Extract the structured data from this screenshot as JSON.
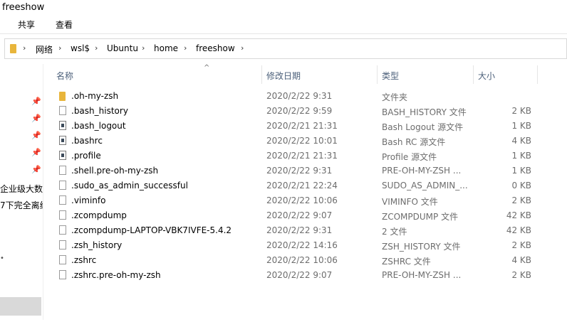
{
  "window": {
    "title": "freeshow"
  },
  "ribbon": {
    "tabs": [
      "共享",
      "查看"
    ]
  },
  "breadcrumb": [
    "网络",
    "wsl$",
    "Ubuntu",
    "home",
    "freeshow"
  ],
  "left_pane": {
    "text1": "企业级大数",
    "text2": "7下完全离线",
    "pin_glyph": "📌"
  },
  "columns": {
    "name": "名称",
    "date": "修改日期",
    "type": "类型",
    "size": "大小"
  },
  "files": [
    {
      "name": ".oh-my-zsh",
      "date": "2020/2/22 9:31",
      "type": "文件夹",
      "size": "",
      "icon": "folder-icon"
    },
    {
      "name": ".bash_history",
      "date": "2020/2/22 9:59",
      "type": "BASH_HISTORY 文件",
      "size": "2 KB",
      "icon": "file-icon"
    },
    {
      "name": ".bash_logout",
      "date": "2020/2/21 21:31",
      "type": "Bash Logout 源文件",
      "size": "1 KB",
      "icon": "shell-script-icon"
    },
    {
      "name": ".bashrc",
      "date": "2020/2/22 10:01",
      "type": "Bash RC 源文件",
      "size": "4 KB",
      "icon": "shell-script-icon"
    },
    {
      "name": ".profile",
      "date": "2020/2/21 21:31",
      "type": "Profile 源文件",
      "size": "1 KB",
      "icon": "shell-script-icon"
    },
    {
      "name": ".shell.pre-oh-my-zsh",
      "date": "2020/2/22 9:31",
      "type": "PRE-OH-MY-ZSH ...",
      "size": "1 KB",
      "icon": "file-icon"
    },
    {
      "name": ".sudo_as_admin_successful",
      "date": "2020/2/21 22:24",
      "type": "SUDO_AS_ADMIN_...",
      "size": "0 KB",
      "icon": "file-icon"
    },
    {
      "name": ".viminfo",
      "date": "2020/2/22 10:06",
      "type": "VIMINFO 文件",
      "size": "2 KB",
      "icon": "file-icon"
    },
    {
      "name": ".zcompdump",
      "date": "2020/2/22 9:07",
      "type": "ZCOMPDUMP 文件",
      "size": "42 KB",
      "icon": "file-icon"
    },
    {
      "name": ".zcompdump-LAPTOP-VBK7IVFE-5.4.2",
      "date": "2020/2/22 9:31",
      "type": "2 文件",
      "size": "42 KB",
      "icon": "file-icon"
    },
    {
      "name": ".zsh_history",
      "date": "2020/2/22 14:16",
      "type": "ZSH_HISTORY 文件",
      "size": "2 KB",
      "icon": "file-icon"
    },
    {
      "name": ".zshrc",
      "date": "2020/2/22 10:06",
      "type": "ZSHRC 文件",
      "size": "4 KB",
      "icon": "file-icon"
    },
    {
      "name": ".zshrc.pre-oh-my-zsh",
      "date": "2020/2/22 9:07",
      "type": "PRE-OH-MY-ZSH ...",
      "size": "2 KB",
      "icon": "file-icon"
    }
  ]
}
